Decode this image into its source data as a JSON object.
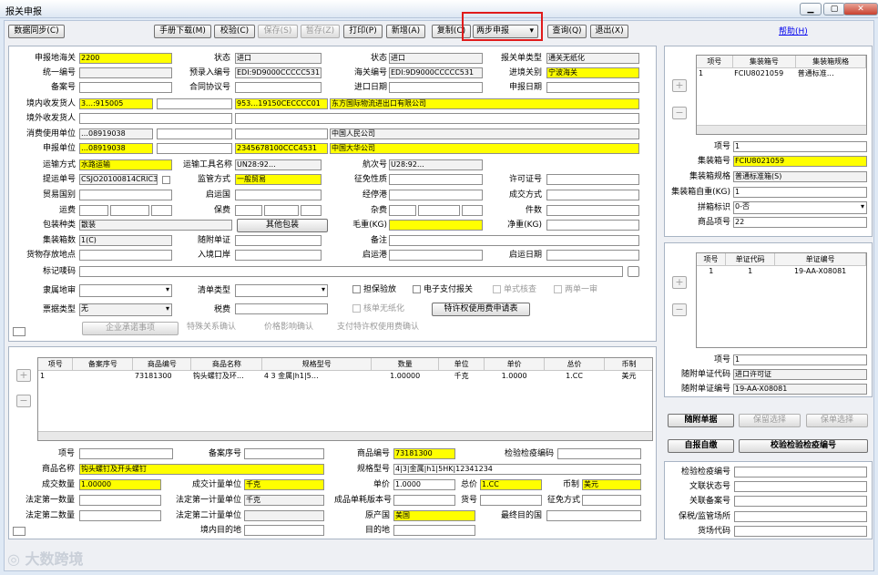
{
  "window": {
    "title": "报关申报",
    "min": "▁",
    "max": "▢",
    "close": "✕"
  },
  "toolbar": {
    "data_sync": "数据同步(C)",
    "manual_download": "手册下载(M)",
    "check": "校验(C)",
    "save": "保存(S)",
    "temp_save": "暂存(Z)",
    "print": "打印(P)",
    "new": "新增(A)",
    "copy": "复制(C)",
    "two_step_declare": "两步申报",
    "query": "查询(Q)",
    "exit": "退出(X)",
    "help": "帮助(H)"
  },
  "header": {
    "declare_customs": {
      "label": "申报地海关",
      "value": "2200"
    },
    "status": {
      "label": "状态",
      "value": "进口"
    },
    "declaration_type": {
      "label": "报关单类型",
      "value": "通关无纸化"
    },
    "unified_no": {
      "label": "统一编号",
      "value": ""
    },
    "pre_entry_no": {
      "label": "预录入编号",
      "value": "EDI:9D9000CCCCC531"
    },
    "customs_no": {
      "label": "海关编号",
      "value": "EDI:9D9000CCCCC531"
    },
    "entry_customs": {
      "label": "进境关别",
      "value": "宁波海关"
    },
    "record_no": {
      "label": "备案号",
      "value": ""
    },
    "contract_no": {
      "label": "合同协议号",
      "value": ""
    },
    "import_date": {
      "label": "进口日期",
      "value": ""
    },
    "declare_date": {
      "label": "申报日期",
      "value": ""
    },
    "consignee_domestic": {
      "label": "境内收发货人",
      "code": "3…:915005",
      "credit": "",
      "ent_code": "953…19150CECCCC01",
      "name": "东方国际物流进出口有限公司"
    },
    "consignor_foreign": {
      "label": "境外收发货人",
      "value": ""
    },
    "consumer_unit": {
      "label": "消费使用单位",
      "code": "…08919038",
      "name": "中国人民公司"
    },
    "declare_unit": {
      "label": "申报单位",
      "code": "…08919038",
      "ent_code": "2345678100CCC4531",
      "name": "中国大华公司"
    },
    "transport_mode": {
      "label": "运输方式",
      "value": "水路运输"
    },
    "vessel_name": {
      "label": "运输工具名称",
      "value": "UN28:92…"
    },
    "voyage_no": {
      "label": "航次号",
      "value": "U28:92…"
    },
    "bill_no": {
      "label": "提运单号",
      "value": "CSJO20100814CRIC3"
    },
    "supervision_mode": {
      "label": "监管方式",
      "value": "一般贸易"
    },
    "levy_nature": {
      "label": "征免性质",
      "value": ""
    },
    "license_no": {
      "label": "许可证号",
      "value": ""
    },
    "trade_country": {
      "label": "贸易国别",
      "value": ""
    },
    "departure_country": {
      "label": "启运国",
      "value": ""
    },
    "transit_port": {
      "label": "经停港",
      "value": ""
    },
    "transaction_mode": {
      "label": "成交方式",
      "value": ""
    },
    "freight": {
      "label": "运费",
      "value": ""
    },
    "insurance": {
      "label": "保费",
      "value": ""
    },
    "misc_fee": {
      "label": "杂费",
      "value": ""
    },
    "packages": {
      "label": "件数",
      "value": ""
    },
    "pack_type": {
      "label": "包装种类",
      "value": "散装"
    },
    "other_pack_btn": "其他包装",
    "gross_weight": {
      "label": "毛重(KG)",
      "value": ""
    },
    "net_weight": {
      "label": "净重(KG)",
      "value": ""
    },
    "container_count": {
      "label": "集装箱数",
      "value": "1(C)"
    },
    "attached_doc": {
      "label": "随附单证",
      "value": ""
    },
    "remarks": {
      "label": "备注",
      "value": ""
    },
    "goods_location": {
      "label": "货物存放地点",
      "value": ""
    },
    "entry_port": {
      "label": "入境口岸",
      "value": ""
    },
    "departure_port": {
      "label": "启运港",
      "value": ""
    },
    "departure_date": {
      "label": "启运日期",
      "value": ""
    },
    "marks": {
      "label": "标记唛码",
      "value": ""
    },
    "affiliation": {
      "label": "隶属地审",
      "value": ""
    },
    "list_type": {
      "label": "清单类型",
      "value": ""
    },
    "ticket_type": {
      "label": "票据类型",
      "value": "无"
    },
    "tax_fee": {
      "label": "税费",
      "value": ""
    },
    "chk_inspection": "担保验放",
    "chk_e_payment": "电子支付报关",
    "chk_bill_check": "单式核查",
    "chk_two_one": "两单一审",
    "chk_no_paper": "核单无纸化",
    "privilege_btn": "特许权使用费申请表",
    "ent_commit_btn": "企业承诺事项",
    "special_relation": "特殊关系确认",
    "price_impact": "价格影响确认",
    "royalty_confirm": "支付特许权使用费确认"
  },
  "container_panel": {
    "columns": [
      "项号",
      "集装箱号",
      "集装箱规格"
    ],
    "rows": [
      [
        "1",
        "FCIU8021059",
        "普通标准…"
      ]
    ],
    "item_no": {
      "label": "项号",
      "value": "1"
    },
    "container_no": {
      "label": "集装箱号",
      "value": "FCIU8021059"
    },
    "spec": {
      "label": "集装箱规格",
      "value": "普通标准箱(S)"
    },
    "weight": {
      "label": "集装箱自重(KG)",
      "value": "1"
    },
    "lcl_flag": {
      "label": "拼箱标识",
      "value": "0-否"
    },
    "goods_item": {
      "label": "商品项号",
      "value": "22"
    }
  },
  "doc_panel": {
    "columns": [
      "项号",
      "单证代码",
      "单证编号"
    ],
    "rows": [
      [
        "1",
        "1",
        "19-AA-X08081"
      ]
    ],
    "item_no": {
      "label": "项号",
      "value": "1"
    },
    "doc_code": {
      "label": "随附单证代码",
      "value": "进口许可证"
    },
    "doc_no": {
      "label": "随附单证编号",
      "value": "19-AA-X08081"
    }
  },
  "right_buttons": {
    "attach": "随附单据",
    "save_select": "保留选择",
    "save_select2": "保单选择",
    "self_report": "自报自缴",
    "inspection_btn": "校验检验检疫编号"
  },
  "inspection": {
    "insp_no": {
      "label": "检验检疫编号",
      "value": ""
    },
    "cert_no": {
      "label": "文联状态号",
      "value": ""
    },
    "related_no": {
      "label": "关联备案号",
      "value": ""
    },
    "bonded": {
      "label": "保税/监管场所",
      "value": ""
    },
    "yard_code": {
      "label": "货场代码",
      "value": ""
    }
  },
  "goods_table": {
    "columns": [
      "项号",
      "备案序号",
      "商品编号",
      "商品名称",
      "规格型号",
      "数量",
      "单位",
      "单价",
      "总价",
      "币制"
    ],
    "rows": [
      [
        "1",
        "",
        "73181300",
        "钩头螺钉及环…",
        "4 3 金属|h1|5…",
        "1.00000",
        "千克",
        "1.0000",
        "1.CC",
        "美元"
      ]
    ]
  },
  "goods": {
    "item_no": {
      "label": "项号",
      "value": ""
    },
    "record_seq": {
      "label": "备案序号",
      "value": ""
    },
    "hs_code": {
      "label": "商品编号",
      "value": "73181300"
    },
    "ciq_code": {
      "label": "检验检疫编码",
      "value": ""
    },
    "name": {
      "label": "商品名称",
      "value": "钩头螺钉及开头螺钉"
    },
    "spec": {
      "label": "规格型号",
      "value": "4|3|金属|h1|5HK|12341234"
    },
    "qty": {
      "label": "成交数量",
      "value": "1.00000"
    },
    "unit": {
      "label": "成交计量单位",
      "value": "千克"
    },
    "price": {
      "label": "单价",
      "value": "1.0000"
    },
    "total": {
      "label": "总价",
      "value": "1.CC"
    },
    "currency": {
      "label": "币制",
      "value": "美元"
    },
    "legal_qty1": {
      "label": "法定第一数量",
      "value": ""
    },
    "legal_unit1": {
      "label": "法定第一计量单位",
      "value": "千克"
    },
    "finished_no": {
      "label": "成品单耗版本号",
      "value": ""
    },
    "goods_no": {
      "label": "货号",
      "value": ""
    },
    "levy_mode": {
      "label": "征免方式",
      "value": ""
    },
    "legal_qty2": {
      "label": "法定第二数量",
      "value": ""
    },
    "legal_unit2": {
      "label": "法定第二计量单位",
      "value": ""
    },
    "origin": {
      "label": "原产国",
      "value": "美国"
    },
    "final_country": {
      "label": "最终目的国",
      "value": ""
    },
    "dest_place": {
      "label": "境内目的地",
      "value": ""
    },
    "dest_region": {
      "label": "目的地",
      "value": ""
    }
  },
  "watermark": "大数跨境"
}
